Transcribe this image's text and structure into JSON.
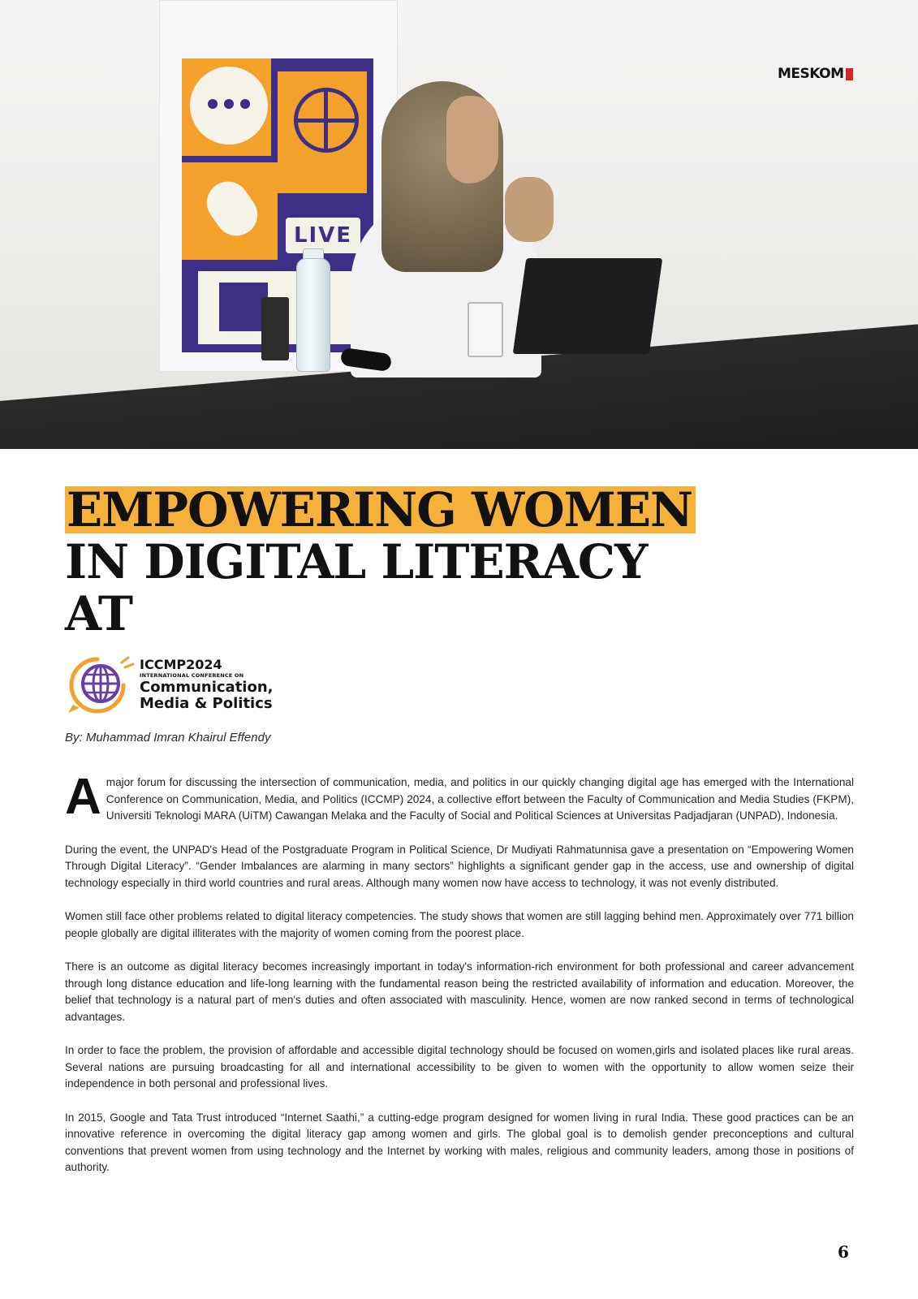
{
  "masthead": {
    "name": "MESKOM"
  },
  "photo": {
    "banner_live_label": "LIVE"
  },
  "headline": {
    "line1": "EMPOWERING WOMEN",
    "line2": "IN DIGITAL LITERACY",
    "line3": "AT",
    "highlight_color": "#f6b13b"
  },
  "conference_logo": {
    "code": "ICCMP2024",
    "subtitle": "INTERNATIONAL CONFERENCE ON",
    "name_line1": "Communication,",
    "name_line2": "Media & Politics",
    "icon": "globe-icon",
    "accent_colors": [
      "#6a3fa0",
      "#f3a12a"
    ]
  },
  "byline": "By: Muhammad Imran Khairul Effendy",
  "article": {
    "dropcap": "A",
    "p1": "major forum for discussing the intersection of communication, media, and politics in our quickly changing digital age has emerged with the International Conference on Communication, Media, and Politics (ICCMP) 2024, a collective effort between the Faculty of Communication and Media Studies (FKPM), Universiti Teknologi MARA (UiTM) Cawangan Melaka and the Faculty of Social and Political Sciences at Universitas Padjadjaran (UNPAD), Indonesia.",
    "p2": "During the event, the UNPAD's Head of the Postgraduate Program in Political Science, Dr Mudiyati Rahmatunnisa gave a presentation on “Empowering Women Through Digital Literacy”. “Gender Imbalances are alarming in many sectors” highlights a significant gender gap in the access, use and ownership of digital technology especially in third world countries and rural areas. Although many women now have access to technology, it was not evenly distributed.",
    "p3": "Women still face other problems related to digital literacy competencies. The study shows that women are still lagging behind men. Approximately over 771 billion people globally are digital illiterates with the majority of women coming from the poorest place.",
    "p4": "There is an outcome as digital literacy becomes increasingly important in today's information-rich environment for both professional and career advancement through long distance education and life-long learning with the fundamental reason being the restricted availability of information and education. Moreover, the belief that technology is a natural part of men's duties and often associated with masculinity. Hence, women are now ranked second in terms of technological advantages.",
    "p5": "In order to face the problem, the provision of affordable and accessible digital technology should be focused on women,girls and isolated places like rural areas. Several nations are pursuing broadcasting for all and international accessibility to be given to women with the opportunity to allow women seize their independence in both personal and professional lives.",
    "p6": "In 2015, Google and Tata Trust introduced “Internet Saathi,” a cutting-edge program designed for women living in rural India. These good practices can be an innovative reference in overcoming the digital literacy gap among women and girls. The global goal is to demolish gender preconceptions and cultural conventions that prevent women from using technology and the Internet by working with males, religious and community leaders, among those in positions of authority."
  },
  "page_number": "6"
}
